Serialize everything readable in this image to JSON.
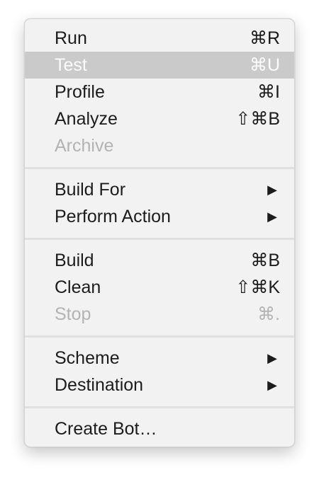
{
  "menu": {
    "groups": [
      {
        "items": [
          {
            "label": "Run",
            "shortcut": "⌘R",
            "state": "enabled"
          },
          {
            "label": "Test",
            "shortcut": "⌘U",
            "state": "highlighted"
          },
          {
            "label": "Profile",
            "shortcut": "⌘I",
            "state": "enabled"
          },
          {
            "label": "Analyze",
            "shortcut": "⇧⌘B",
            "state": "enabled"
          },
          {
            "label": "Archive",
            "shortcut": "",
            "state": "disabled"
          }
        ]
      },
      {
        "items": [
          {
            "label": "Build For",
            "submenu_arrow": "▶",
            "state": "enabled"
          },
          {
            "label": "Perform Action",
            "submenu_arrow": "▶",
            "state": "enabled"
          }
        ]
      },
      {
        "items": [
          {
            "label": "Build",
            "shortcut": "⌘B",
            "state": "enabled"
          },
          {
            "label": "Clean",
            "shortcut": "⇧⌘K",
            "state": "enabled"
          },
          {
            "label": "Stop",
            "shortcut": "⌘.",
            "state": "disabled"
          }
        ]
      },
      {
        "items": [
          {
            "label": "Scheme",
            "submenu_arrow": "▶",
            "state": "enabled"
          },
          {
            "label": "Destination",
            "submenu_arrow": "▶",
            "state": "enabled"
          }
        ]
      },
      {
        "items": [
          {
            "label": "Create Bot…",
            "shortcut": "",
            "state": "enabled"
          }
        ]
      }
    ]
  },
  "colors": {
    "menu_background": "#f2f2f2",
    "highlight": "#cacaca",
    "disabled_text": "#b3b3b3",
    "text": "#1c1c1c"
  }
}
